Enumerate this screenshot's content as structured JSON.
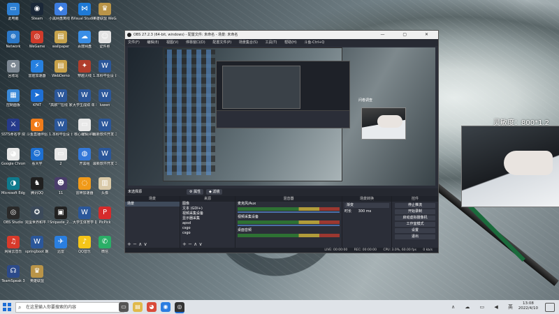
{
  "desktop": {
    "icons": [
      {
        "label": "此电脑",
        "color": "#2d7fd2",
        "glyph": "▭"
      },
      {
        "label": "Steam",
        "color": "#1b2838",
        "glyph": "◉"
      },
      {
        "label": "小黑网盘离线\n板",
        "color": "#3d7de0",
        "glyph": "◆"
      },
      {
        "label": "Visual\nStudio Code",
        "color": "#1f7ad6",
        "glyph": "⋈"
      },
      {
        "label": "英雄联盟\nWeGame版",
        "color": "#b99448",
        "glyph": "♛"
      },
      {
        "label": "Network",
        "color": "#2c79c9",
        "glyph": "⊕"
      },
      {
        "label": "WeGame",
        "color": "#d03b2b",
        "glyph": "◎"
      },
      {
        "label": "wallpaper",
        "color": "#c7a34c",
        "glyph": "▤"
      },
      {
        "label": "百度网盘",
        "color": "#3a8ee6",
        "glyph": "☁"
      },
      {
        "label": "证件照",
        "color": "#e2e2e2",
        "glyph": "☺"
      },
      {
        "label": "回收站",
        "color": "#7d8893",
        "glyph": "♻"
      },
      {
        "label": "雷霆加速器",
        "color": "#2680e0",
        "glyph": "⚡"
      },
      {
        "label": "WebDemo",
        "color": "#c9a24a",
        "glyph": "▤"
      },
      {
        "label": "穿越火线",
        "color": "#b03d2c",
        "glyph": "✦"
      },
      {
        "label": "1.本科毕业设\n计论文(全...",
        "color": "#2b579a",
        "glyph": "W"
      },
      {
        "label": "控制面板",
        "color": "#3b8ad8",
        "glyph": "▦"
      },
      {
        "label": "KFAT",
        "color": "#1e6fd4",
        "glyph": "➤"
      },
      {
        "label": "\"高薪\"\"在线\n家数字化证",
        "color": "#2b579a",
        "glyph": "W"
      },
      {
        "label": "大学生成绩\n单 精简",
        "color": "#2b579a",
        "glyph": "W"
      },
      {
        "label": "luwen",
        "color": "#2b579a",
        "glyph": "W"
      },
      {
        "label": "SSTS命名学\n院",
        "color": "#263a8a",
        "glyph": "⚔"
      },
      {
        "label": "斗鱼直播伴侣",
        "color": "#f07c1b",
        "glyph": "◐"
      },
      {
        "label": "1.本科毕业设\n计论文(全...",
        "color": "#2b579a",
        "glyph": "W"
      },
      {
        "label": "核心编辑评审",
        "color": "#e8e8e8",
        "glyph": "▭"
      },
      {
        "label": "最新软件开发\n工作流程",
        "color": "#2b579a",
        "glyph": "W"
      },
      {
        "label": "Google\nChrome",
        "color": "#e8e8e8",
        "glyph": "◕"
      },
      {
        "label": "看大学",
        "color": "#1d6fd1",
        "glyph": "☺"
      },
      {
        "label": "2",
        "color": "#e8e8e8",
        "glyph": "▭"
      },
      {
        "label": "开黑组",
        "color": "#3478d8",
        "glyph": "◍"
      },
      {
        "label": "最新软件开发\n工作流程（精...",
        "color": "#2b579a",
        "glyph": "W"
      },
      {
        "label": "Microsoft\nEdge",
        "color": "#0f7a8d",
        "glyph": "◑"
      },
      {
        "label": "腾讯QQ",
        "color": "#202020",
        "glyph": "♞"
      },
      {
        "label": "11",
        "color": "#4a3d6b",
        "glyph": "☻"
      },
      {
        "label": "雷神加速器",
        "color": "#f09a1a",
        "glyph": "◌"
      },
      {
        "label": "头像",
        "color": "#d9c9a8",
        "glyph": "▥"
      },
      {
        "label": "OBS Studio",
        "color": "#2a2a2a",
        "glyph": "◎"
      },
      {
        "label": "完蛋世界和平\n平台",
        "color": "#3c4a5a",
        "glyph": "✪"
      },
      {
        "label": "Snipaste_2...",
        "color": "#222222",
        "glyph": "▣"
      },
      {
        "label": "大学生体育学\n能评比...",
        "color": "#2b579a",
        "glyph": "W"
      },
      {
        "label": "PicPick",
        "color": "#d62b2b",
        "glyph": "P"
      },
      {
        "label": "网易云音乐",
        "color": "#d83a2b",
        "glyph": "♫"
      },
      {
        "label": "springboot\n期末课程设计...",
        "color": "#2b579a",
        "glyph": "W"
      },
      {
        "label": "迅雷",
        "color": "#2a7fe0",
        "glyph": "✈"
      },
      {
        "label": "QQ音乐",
        "color": "#f5c518",
        "glyph": "♪"
      },
      {
        "label": "微信",
        "color": "#2aae67",
        "glyph": "✆"
      },
      {
        "label": "TeamSpeak\n3",
        "color": "#2c4a8a",
        "glyph": "☊"
      },
      {
        "label": "英雄联盟",
        "color": "#b99448",
        "glyph": "♛"
      }
    ],
    "sensitivity_text": "灵敏度：800*1.2"
  },
  "obs": {
    "title": "OBS 27.2.3 (64-bit, windows) - 配置文件: 未命名 - 场景: 未命名",
    "window_buttons": "— ▢ ✕",
    "menu": [
      "文件(F)",
      "编辑(E)",
      "视图(V)",
      "停靠窗口(D)",
      "配置文件(P)",
      "场景集合(S)",
      "工具(T)",
      "帮助(H)",
      "斗鱼-Ctrl+Q"
    ],
    "preview_caption": "问卷调查",
    "scene_bar": {
      "current": "未选择源",
      "properties": "⚙ 属性",
      "filters": "◆ 滤镜"
    },
    "docks": {
      "scenes": {
        "title": "场景",
        "items": [
          "场景"
        ]
      },
      "sources": {
        "title": "来源",
        "items": [
          "图像",
          "文本 (GDI+)",
          "视频采集设备",
          "显示器采集",
          "apsd",
          "csgo",
          "csgo"
        ]
      },
      "mixer": {
        "title": "混音器",
        "channels": [
          "麦克风/Aux",
          "视频采集设备",
          "桌面音频"
        ]
      },
      "transitions": {
        "title": "场景转换",
        "type": "渐变",
        "duration_label": "时长",
        "duration": "300 ms"
      },
      "controls": {
        "title": "控件",
        "buttons": [
          "停止推流",
          "开始录制",
          "启动虚拟摄像机",
          "工作室模式",
          "设置",
          "退出"
        ]
      },
      "footer": "+ − ∧ ∨"
    },
    "status": {
      "live": "LIVE: 00:00:00",
      "rec": "REC: 00:00:00",
      "cpu": "CPU: 3.0%, 60.00 fps",
      "kbps": "0 kb/s"
    }
  },
  "taskbar": {
    "search_placeholder": "在这里输入你要搜索的内容",
    "search_icon": "⌕",
    "tray_icons": "∧ ☁ ▭ ◀ 英",
    "time": "13:08",
    "date": "2022/4/10"
  }
}
